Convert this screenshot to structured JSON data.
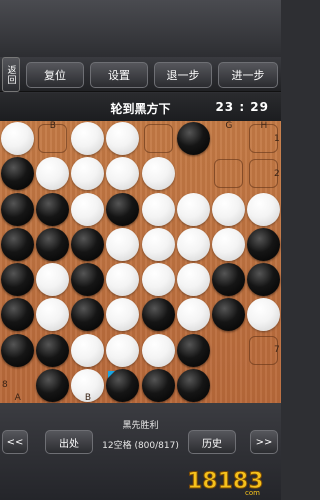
{
  "toolbar": {
    "back_label": "返回",
    "reset_label": "复位",
    "settings_label": "设置",
    "undo_label": "退一步",
    "redo_label": "进一步"
  },
  "status": {
    "turn_text": "轮到黑方下",
    "clock": "23 : 29"
  },
  "board": {
    "size": 8,
    "col_labels_top": {
      "B": 1,
      "G": 6,
      "H": 7
    },
    "col_labels_bottom": {
      "A": 0,
      "B": 2
    },
    "row_labels_right": {
      "1": 0,
      "2": 1,
      "7": 6
    },
    "row_labels_left": {
      "8": 7
    },
    "grid": [
      "WHWWHB.H",
      "BWWWW.HH",
      "BBWBWWWW",
      "BBBWWWWB",
      "BWBWWWBB",
      "BWBWBWBW",
      "BBWWWB.H",
      ".BWBBB.."
    ],
    "last_move": [
      7,
      3
    ],
    "colors": {
      "white": "#f4f4f4",
      "black": "#111111",
      "board": "#c0733e"
    }
  },
  "bottom": {
    "prev_label": "<<",
    "exit_label": "出处",
    "result_text": "黑先胜利",
    "empties_text": "12空格 (800/817)",
    "history_label": "历史",
    "next_label": ">>"
  },
  "watermark": {
    "text": "18183",
    "sub": "com"
  }
}
